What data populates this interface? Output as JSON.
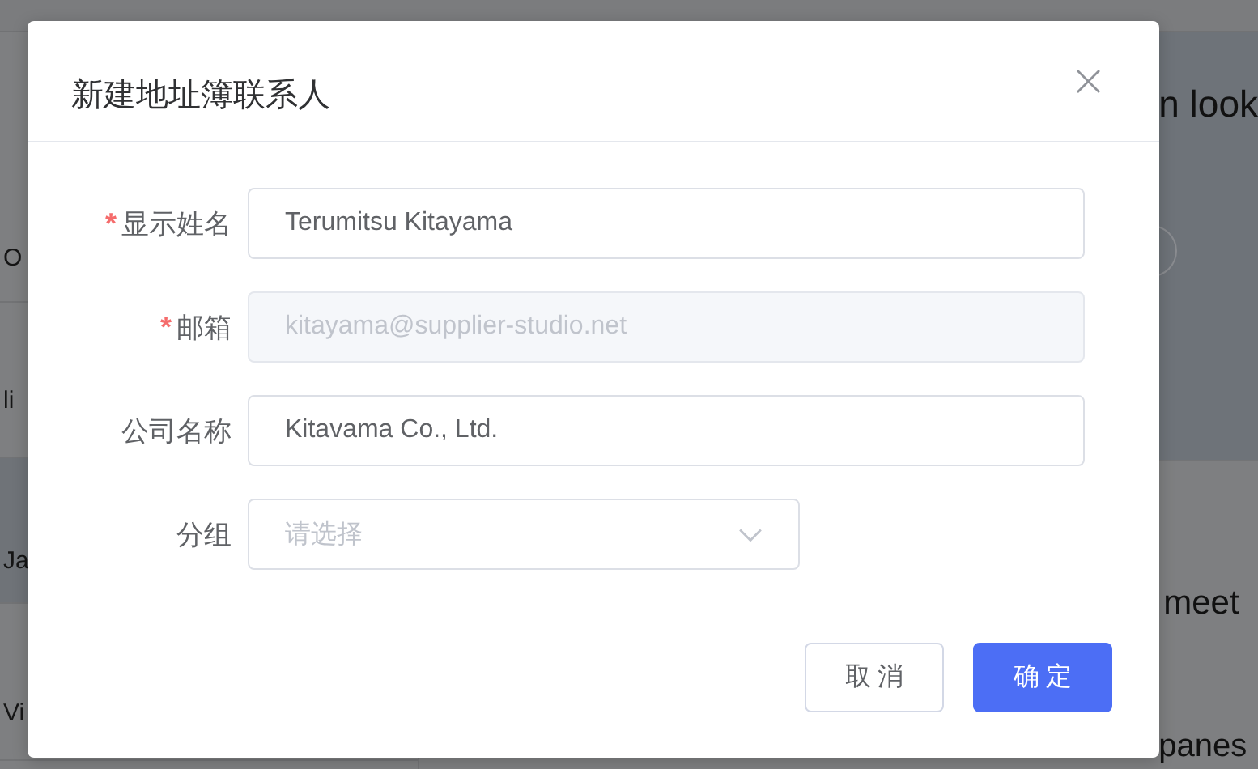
{
  "sidebar": {
    "items": [
      {
        "label": "O",
        "selected": false
      },
      {
        "label": "li",
        "selected": false
      },
      {
        "label": "Ja",
        "selected": true
      },
      {
        "label": "Vi",
        "selected": false
      }
    ]
  },
  "main": {
    "heading": "n look",
    "texts": [
      "meet",
      "panes"
    ]
  },
  "dialog": {
    "title": "新建地址簿联系人",
    "close": "×",
    "fields": [
      {
        "kind": "input",
        "required_mark": "*",
        "label": "显示姓名",
        "value": "Terumitsu Kitayama",
        "disabled": false
      },
      {
        "kind": "input",
        "required_mark": "*",
        "label": "邮箱",
        "value": "kitayama@supplier-studio.net",
        "disabled": true
      },
      {
        "kind": "input",
        "label": "公司名称",
        "value": "Kitavama Co., Ltd.",
        "disabled": false
      },
      {
        "kind": "select",
        "label": "分组",
        "placeholder": "请选择"
      }
    ],
    "buttons": [
      {
        "kind": "secondary",
        "label": "取 消"
      },
      {
        "kind": "primary",
        "label": "确 定"
      }
    ]
  }
}
